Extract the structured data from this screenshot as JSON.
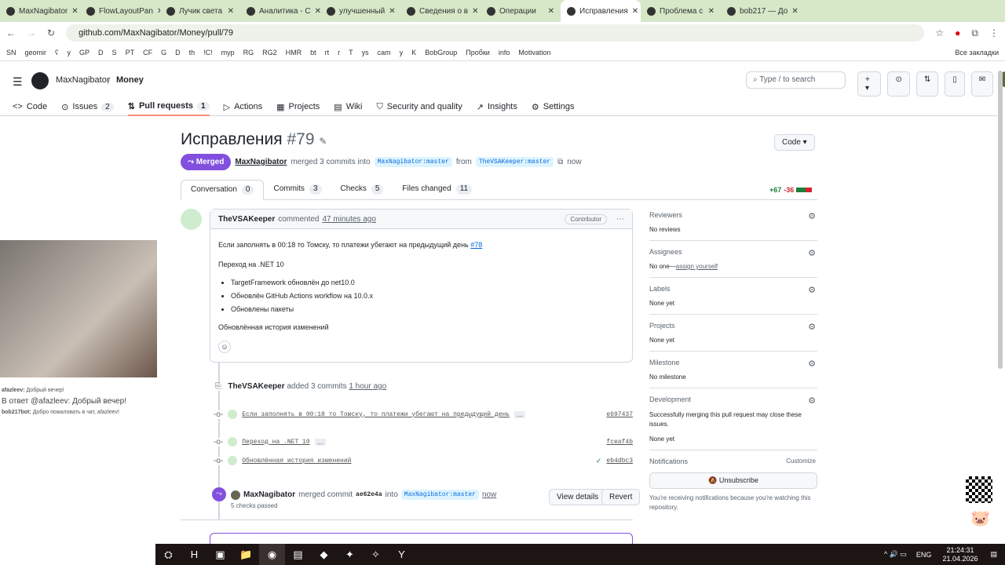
{
  "browser": {
    "tabs": [
      "MaxNagibator",
      "FlowLayoutPan",
      "Лучик света",
      "Аналитика - С",
      "улучшенный",
      "Сведения о в",
      "Операции",
      "Исправления",
      "Проблема с",
      "bob217 — До"
    ],
    "active_tab": 7,
    "url": "github.com/MaxNagibator/Money/pull/79",
    "bookmarks": [
      "SN",
      "geomir",
      "ʕ",
      "y",
      "GP",
      "D",
      "S",
      "PT",
      "CF",
      "G",
      "D",
      "th",
      "!C!",
      "myp",
      "RG",
      "RG2",
      "HMR",
      "bt",
      "rt",
      "r",
      "T",
      "ys",
      "cam",
      "y",
      "K",
      "BobGroup",
      "Пробки",
      "info",
      "Motivation"
    ],
    "all_bookmarks": "Все закладки"
  },
  "header": {
    "owner": "MaxNagibator",
    "repo": "Money",
    "search": "Type / to search"
  },
  "repo_nav": [
    {
      "label": "Code",
      "icon": "code-icon"
    },
    {
      "label": "Issues",
      "count": "2",
      "icon": "issue-icon"
    },
    {
      "label": "Pull requests",
      "count": "1",
      "icon": "pr-icon"
    },
    {
      "label": "Actions",
      "icon": "play-icon"
    },
    {
      "label": "Projects",
      "icon": "table-icon"
    },
    {
      "label": "Wiki",
      "icon": "book-icon"
    },
    {
      "label": "Security and quality",
      "icon": "shield-icon"
    },
    {
      "label": "Insights",
      "icon": "graph-icon"
    },
    {
      "label": "Settings",
      "icon": "gear-icon"
    }
  ],
  "pr": {
    "title": "Исправления",
    "number": "#79",
    "code_button": "Code",
    "state": "Merged",
    "author": "MaxNagibator",
    "merged_text": "merged 3 commits into",
    "base": "MaxNagibator:master",
    "from": "from",
    "head": "TheVSAKeeper:master",
    "time": "now",
    "tabs": [
      {
        "label": "Conversation",
        "count": "0"
      },
      {
        "label": "Commits",
        "count": "3"
      },
      {
        "label": "Checks",
        "count": "5"
      },
      {
        "label": "Files changed",
        "count": "11"
      }
    ],
    "additions": "+67",
    "deletions": "-36"
  },
  "comment": {
    "author": "TheVSAKeeper",
    "action": "commented",
    "time": "47 minutes ago",
    "badge": "Contributor",
    "line1": "Если заполнять в 00:18 то Томску, то платежи убегают на предыдущий день",
    "issue_ref": "#78",
    "line2": "Переход на .NET 10",
    "bullets": [
      "TargetFramework обновлён до net10.0",
      "Обновлён GitHub Actions workflow на 10.0.x",
      "Обновлены пакеты"
    ],
    "line3": "Обновлённая история изменений"
  },
  "timeline": {
    "added_author": "TheVSAKeeper",
    "added_text": "added 3 commits",
    "added_time": "1 hour ago",
    "commits": [
      {
        "msg": "Если заполнять в 00:18 то Томску, то платежи убегают на предыдущий день",
        "sha": "e697437"
      },
      {
        "msg": "Переход на .NET 10",
        "sha": "fceaf4b"
      },
      {
        "msg": "Обновлённая история изменений",
        "sha": "eb4dbc3"
      }
    ],
    "merge_author": "MaxNagibator",
    "merge_text": "merged commit",
    "merge_sha": "ae62e4a",
    "into": "into",
    "merge_base": "MaxNagibator:master",
    "merge_time": "now",
    "checks": "5 checks passed",
    "view_details": "View details",
    "revert": "Revert"
  },
  "sidebar": {
    "reviewers": {
      "title": "Reviewers",
      "value": "No reviews"
    },
    "assignees": {
      "title": "Assignees",
      "value": "No one—",
      "link": "assign yourself"
    },
    "labels": {
      "title": "Labels",
      "value": "None yet"
    },
    "projects": {
      "title": "Projects",
      "value": "None yet"
    },
    "milestone": {
      "title": "Milestone",
      "value": "No milestone"
    },
    "development": {
      "title": "Development",
      "text": "Successfully merging this pull request may close these issues.",
      "value": "None yet"
    },
    "notifications": {
      "title": "Notifications",
      "customize": "Customize",
      "button": "Unsubscribe",
      "text": "You're receiving notifications because you're watching this repository."
    }
  },
  "stream_chat": [
    {
      "user": "afazleev:",
      "text": "Добрый вечер!"
    },
    {
      "reply": "В ответ @afazleev: Добрый вечер!"
    },
    {
      "user": "bob217bot:",
      "text": "Добро пожаловать в чат, afazleev!"
    }
  ],
  "taskbar": {
    "lang": "ENG",
    "time": "21:24:31",
    "date": "21.04.2026"
  },
  "colors": {
    "merged": "#8250df",
    "link": "#0969da",
    "add": "#1a7f37",
    "del": "#d1242f"
  }
}
